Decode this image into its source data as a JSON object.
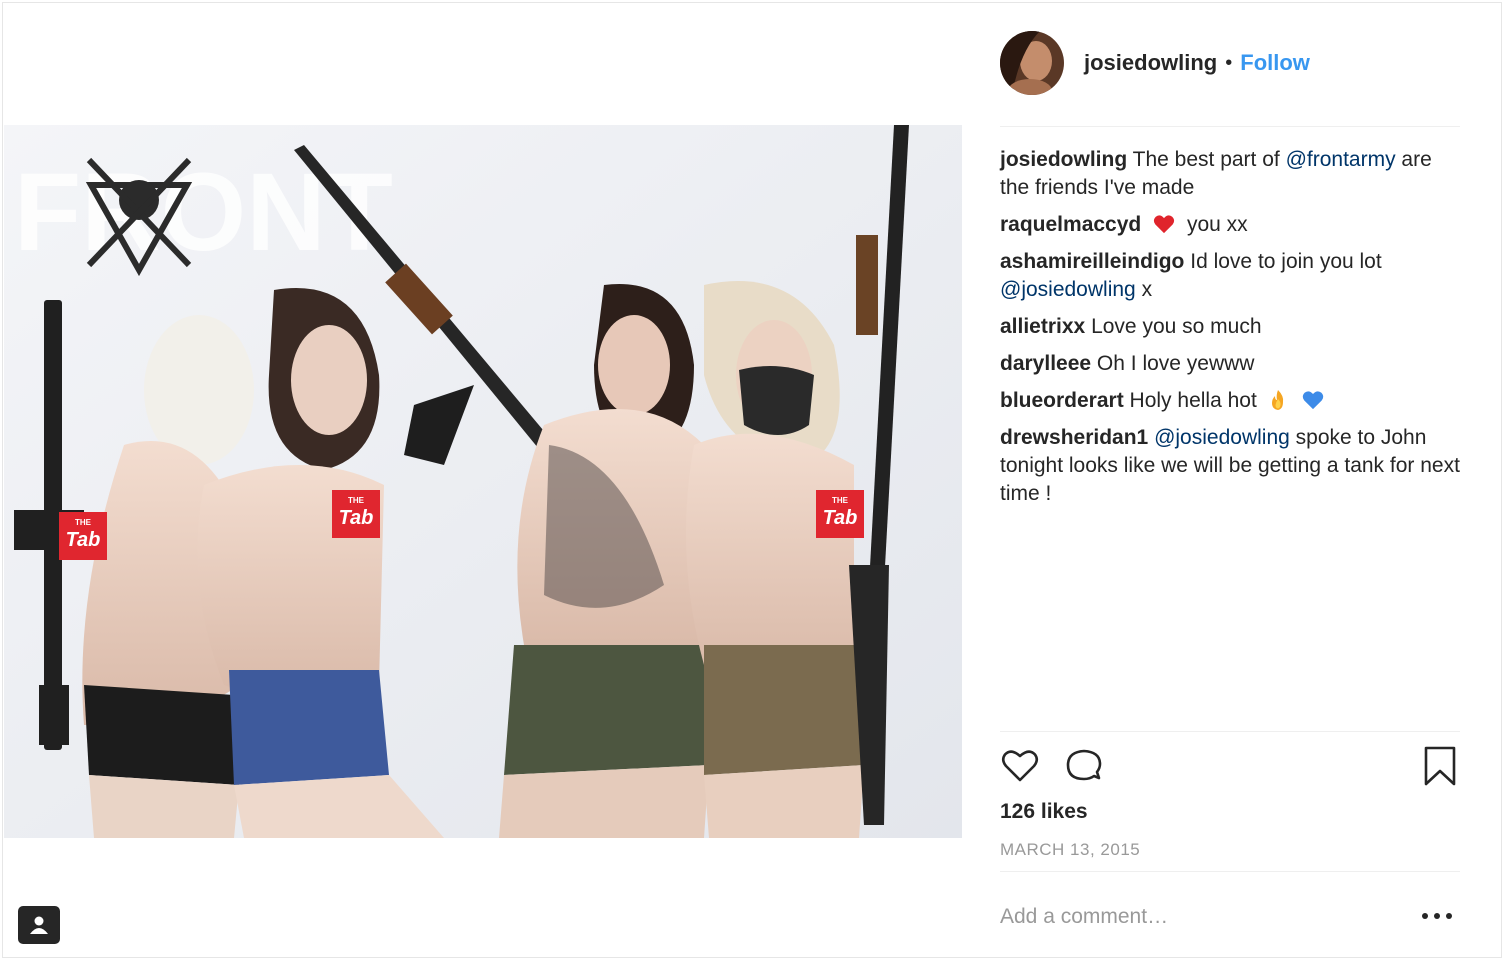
{
  "post": {
    "username": "josiedowling",
    "follow_label": "Follow",
    "separator": "•",
    "caption": {
      "user": "josiedowling",
      "text_before": "The best part of ",
      "mention": "@frontarmy",
      "text_after": " are the friends I've made"
    },
    "comments": [
      {
        "user": "raquelmaccyd",
        "emoji": "heart-emoji",
        "text": "you xx"
      },
      {
        "user": "ashamireilleindigo",
        "text": "Id love to join you lot ",
        "mention": "@josiedowling",
        "text_after": " x"
      },
      {
        "user": "allietrixx",
        "text": "Love you so much"
      },
      {
        "user": "darylleee",
        "text": "Oh I love yewww"
      },
      {
        "user": "blueorderart",
        "text": "Holy hella hot",
        "emojis": [
          "fire-emoji",
          "blue-heart-emoji"
        ]
      },
      {
        "user": "drewsheridan1",
        "mention": "@josiedowling",
        "text_after": " spoke to John tonight looks like we will be getting a tank for next time !"
      }
    ],
    "likes": "126 likes",
    "date": "MARCH 13, 2015",
    "add_comment_placeholder": "Add a comment…",
    "icons": {
      "like": "heart-outline-icon",
      "comment": "speech-bubble-icon",
      "save": "bookmark-icon",
      "more": "ellipsis-icon",
      "tag": "person-tag-icon"
    },
    "media": {
      "watermark_text": "FRONT",
      "badge_text": "Tab",
      "badge_small_text": "THE",
      "badge_color": "#e0262f"
    },
    "colors": {
      "link": "#3897f0",
      "mention": "#003569",
      "muted": "#999999"
    }
  }
}
